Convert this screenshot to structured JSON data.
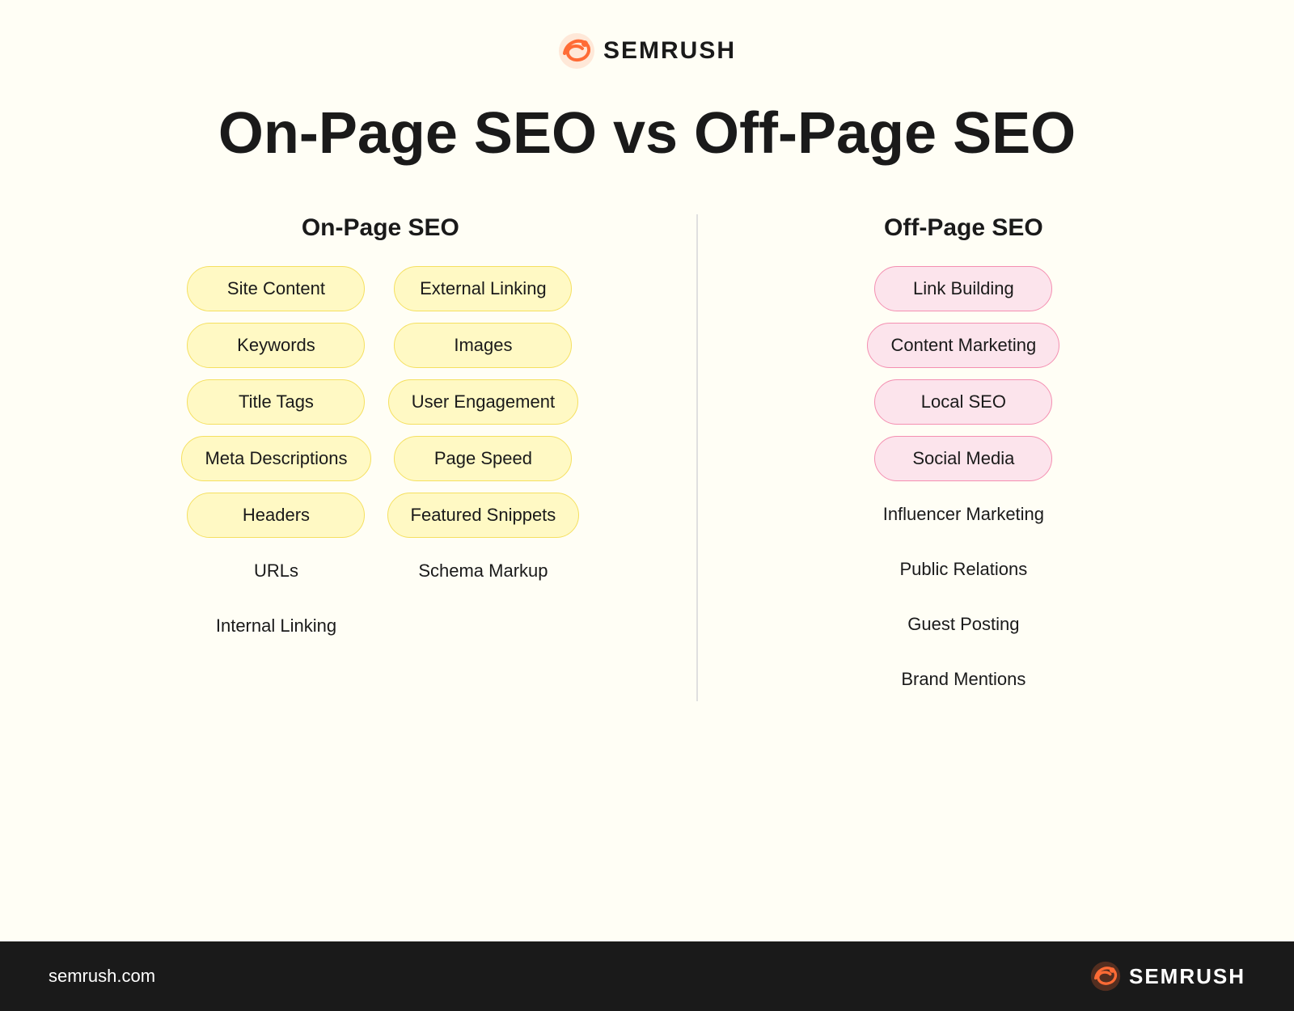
{
  "header": {
    "logo_text": "SEMRUSH",
    "title": "On-Page SEO vs Off-Page SEO"
  },
  "onpage_column": {
    "header": "On-Page SEO",
    "left_items": [
      {
        "label": "Site Content",
        "style": "yellow"
      },
      {
        "label": "Keywords",
        "style": "yellow"
      },
      {
        "label": "Title Tags",
        "style": "yellow"
      },
      {
        "label": "Meta Descriptions",
        "style": "yellow"
      },
      {
        "label": "Headers",
        "style": "yellow"
      },
      {
        "label": "URLs",
        "style": "plain"
      },
      {
        "label": "Internal Linking",
        "style": "plain"
      }
    ],
    "right_items": [
      {
        "label": "External Linking",
        "style": "yellow"
      },
      {
        "label": "Images",
        "style": "yellow"
      },
      {
        "label": "User Engagement",
        "style": "yellow"
      },
      {
        "label": "Page Speed",
        "style": "yellow"
      },
      {
        "label": "Featured Snippets",
        "style": "yellow"
      },
      {
        "label": "Schema Markup",
        "style": "plain"
      }
    ]
  },
  "offpage_column": {
    "header": "Off-Page SEO",
    "items": [
      {
        "label": "Link Building",
        "style": "pink"
      },
      {
        "label": "Content Marketing",
        "style": "pink"
      },
      {
        "label": "Local SEO",
        "style": "pink"
      },
      {
        "label": "Social Media",
        "style": "pink"
      },
      {
        "label": "Influencer Marketing",
        "style": "plain"
      },
      {
        "label": "Public Relations",
        "style": "plain"
      },
      {
        "label": "Guest Posting",
        "style": "plain"
      },
      {
        "label": "Brand Mentions",
        "style": "plain"
      }
    ]
  },
  "footer": {
    "url": "semrush.com",
    "logo_text": "SEMRUSH"
  }
}
